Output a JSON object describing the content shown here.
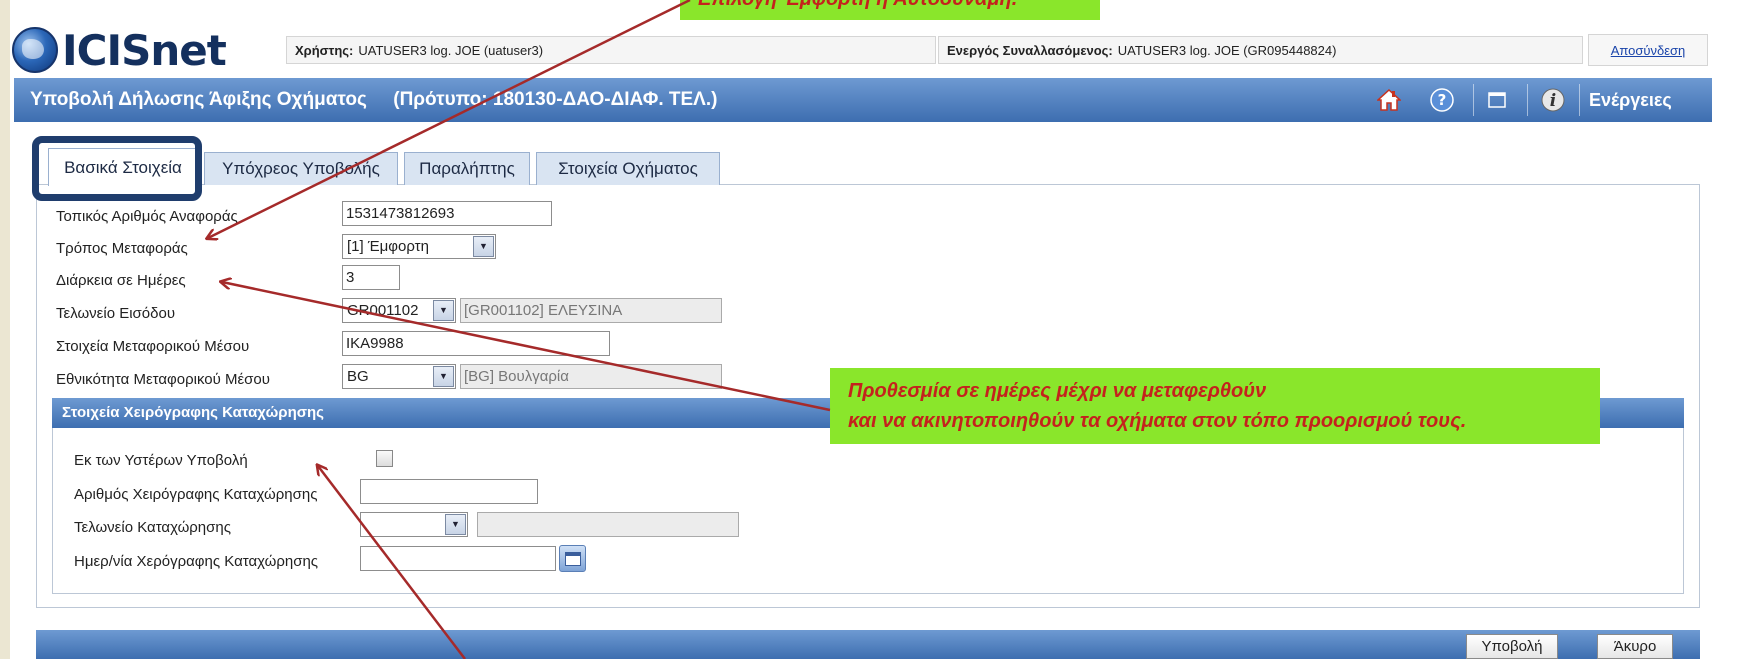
{
  "app": {
    "logo_text": "ICISnet"
  },
  "header": {
    "user_label": "Χρήστης:",
    "user_value": "UATUSER3 log. JOE (uatuser3)",
    "trader_label": "Ενεργός Συναλλασόμενος:",
    "trader_value": "UATUSER3 log. JOE (GR095448824)",
    "logout": "Αποσύνδεση"
  },
  "titlebar": {
    "title": "Υποβολή Δήλωσης Άφιξης Οχήματος",
    "template": "(Πρότυπο: 180130-ΔΑΟ-ΔΙΑΦ. ΤΕΛ.)",
    "actions": "Ενέργειες",
    "icons": [
      "home-icon",
      "help-icon",
      "window-icon",
      "info-icon"
    ]
  },
  "tabs": [
    "Βασικά Στοιχεία",
    "Υπόχρεος Υποβολής",
    "Παραλήπτης",
    "Στοιχεία Οχήματος"
  ],
  "form": {
    "local_ref_label": "Τοπικός Αριθμός Αναφοράς",
    "local_ref_value": "1531473812693",
    "transport_mode_label": "Τρόπος Μεταφοράς",
    "transport_mode_value": "[1] Έμφορτη",
    "duration_label": "Διάρκεια σε Ημέρες",
    "duration_value": "3",
    "entry_office_label": "Τελωνείο Εισόδου",
    "entry_office_code": "GR001102",
    "entry_office_desc": "[GR001102] ΕΛΕΥΣΙΝΑ",
    "vehicle_id_label": "Στοιχεία Μεταφορικού Μέσου",
    "vehicle_id_value": "IKA9988",
    "nationality_label": "Εθνικότητα Μεταφορικού Μέσου",
    "nationality_code": "BG",
    "nationality_desc": "[BG] Βουλγαρία"
  },
  "manual": {
    "heading": "Στοιχεία Χειρόγραφης Καταχώρησης",
    "late_label": "Εκ των Υστέρων Υποβολή",
    "number_label": "Αριθμός Χειρόγραφης Καταχώρησης",
    "office_label": "Τελωνείο Καταχώρησης",
    "date_label": "Ημερ/νία Χερόγραφης Καταχώρησης"
  },
  "buttons": {
    "submit": "Υποβολή",
    "cancel": "Άκυρο"
  },
  "callouts": {
    "top": "Επιλογή Έμφορτη ή Αυτοδύναμη.",
    "duration_line1": "Προθεσμία σε ημέρες μέχρι να μεταφερθούν",
    "duration_line2": "και να ακινητοποιηθούν τα οχήματα στον τόπο προορισμού τους."
  },
  "colors": {
    "header_blue": "#3d6eb0",
    "callout_green": "#8ae62b",
    "callout_text": "#c4221d",
    "arrow": "#a52a2a"
  }
}
